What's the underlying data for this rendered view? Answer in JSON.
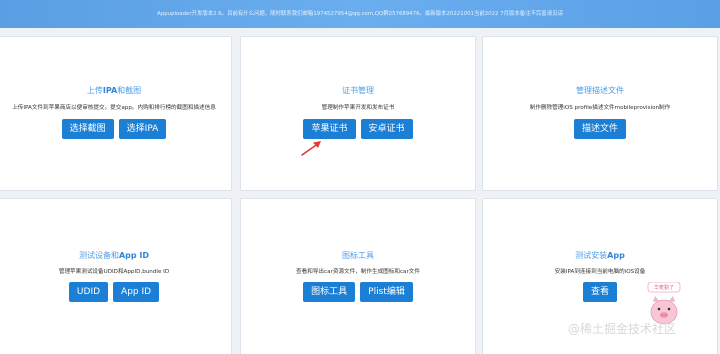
{
  "banner": {
    "text": "Appuploader开发版本2.6。目前有什么问题，随时联系我们邮箱1974527954@qq.com,QQ群257689476。最新版本20221001当前2022 7月版本备注不完善请见谅"
  },
  "cards": [
    {
      "title_pre": "上传",
      "title_bold": "IPA",
      "title_post": "和截图",
      "desc": "上传IPA文件到苹果商店以便审核提交。提交app。内购和排行榜的截图和描述信息",
      "buttons": [
        "选择截图",
        "选择IPA"
      ]
    },
    {
      "title_pre": "证书管理",
      "title_bold": "",
      "title_post": "",
      "desc": "管理制作苹果开发和发布证书",
      "buttons": [
        "苹果证书",
        "安卓证书"
      ]
    },
    {
      "title_pre": "管理描述文件",
      "title_bold": "",
      "title_post": "",
      "desc": "制作删除管理iOS profile描述文件mobileprovision制作",
      "buttons": [
        "描述文件"
      ]
    },
    {
      "title_pre": "测试设备和",
      "title_bold": "App ID",
      "title_post": "",
      "desc": "管理苹果测试设备UDID和AppID,bundle ID",
      "buttons": [
        "UDID",
        "App ID"
      ]
    },
    {
      "title_pre": "图标工具",
      "title_bold": "",
      "title_post": "",
      "desc": "查看和导出car资源文件，制作生成图标和car文件",
      "buttons": [
        "图标工具",
        "Plist编辑"
      ]
    },
    {
      "title_pre": "测试安装",
      "title_bold": "App",
      "title_post": "",
      "desc": "安装IPA到连接到当前电脑的iOS设备",
      "buttons": [
        "查看"
      ]
    }
  ],
  "mascot": {
    "bubble": "华麦勤了"
  },
  "watermark": "@稀土掘金技术社区",
  "colors": {
    "banner": "#64a8ec",
    "button": "#1b7fd6",
    "title": "#4e9ce6",
    "arrow": "#e53935"
  }
}
